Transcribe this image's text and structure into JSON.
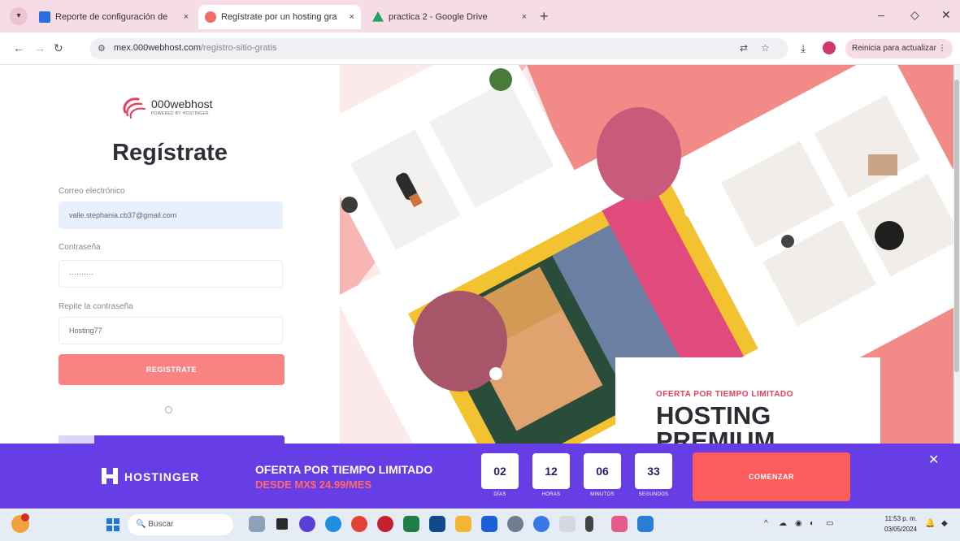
{
  "browser": {
    "tabs": [
      {
        "label": "Reporte de configuración de",
        "favicon_color": "#2b6de0"
      },
      {
        "label": "Regístrate por un hosting gra",
        "favicon_color": "#f26b6b"
      },
      {
        "label": "practica 2 - Google Drive",
        "favicon_color": "#1fa463"
      }
    ],
    "new_tab": "+",
    "close_glyph": "×",
    "window": {
      "minimize": "–",
      "restore": "◇",
      "close": "✕"
    },
    "url_host": "mex.000webhost.com",
    "url_path": "/registro-sitio-gratis",
    "relaunch_label": "Reinicia para actualizar"
  },
  "signup": {
    "logo_text": "000webhost",
    "logo_sub": "POWERED BY HOSTINGER",
    "title": "Regístrate",
    "email_label": "Correo electrónico",
    "email_value": "valle.stephania.cb37@gmail.com",
    "password_label": "Contraseña",
    "password_value": "··········",
    "repeat_label": "Repite la contraseña",
    "repeat_value": "Hosting77",
    "submit_label": "REGISTRATE"
  },
  "hero": {
    "offer_kicker": "OFERTA POR TIEMPO LIMITADO",
    "offer_headline_1": "HOSTING",
    "offer_headline_2": "PREMIUM"
  },
  "promo": {
    "brand": "HOSTINGER",
    "title": "OFERTA POR TIEMPO LIMITADO",
    "price": "DESDE MX$ 24.99/MES",
    "countdown": [
      {
        "value": "02",
        "label": "DÍAS"
      },
      {
        "value": "12",
        "label": "HORAS"
      },
      {
        "value": "06",
        "label": "MINUTOS"
      },
      {
        "value": "33",
        "label": "SEGUNDOS"
      }
    ],
    "cta": "COMENZAR",
    "close": "✕"
  },
  "taskbar": {
    "search_label": "Buscar",
    "time": "11:53 p. m.",
    "date": "03/05/2024"
  },
  "colors": {
    "accent_purple": "#673de6",
    "coral": "#f98383",
    "hero_pink": "#f28b88",
    "offer_red": "#ea3e5c"
  }
}
